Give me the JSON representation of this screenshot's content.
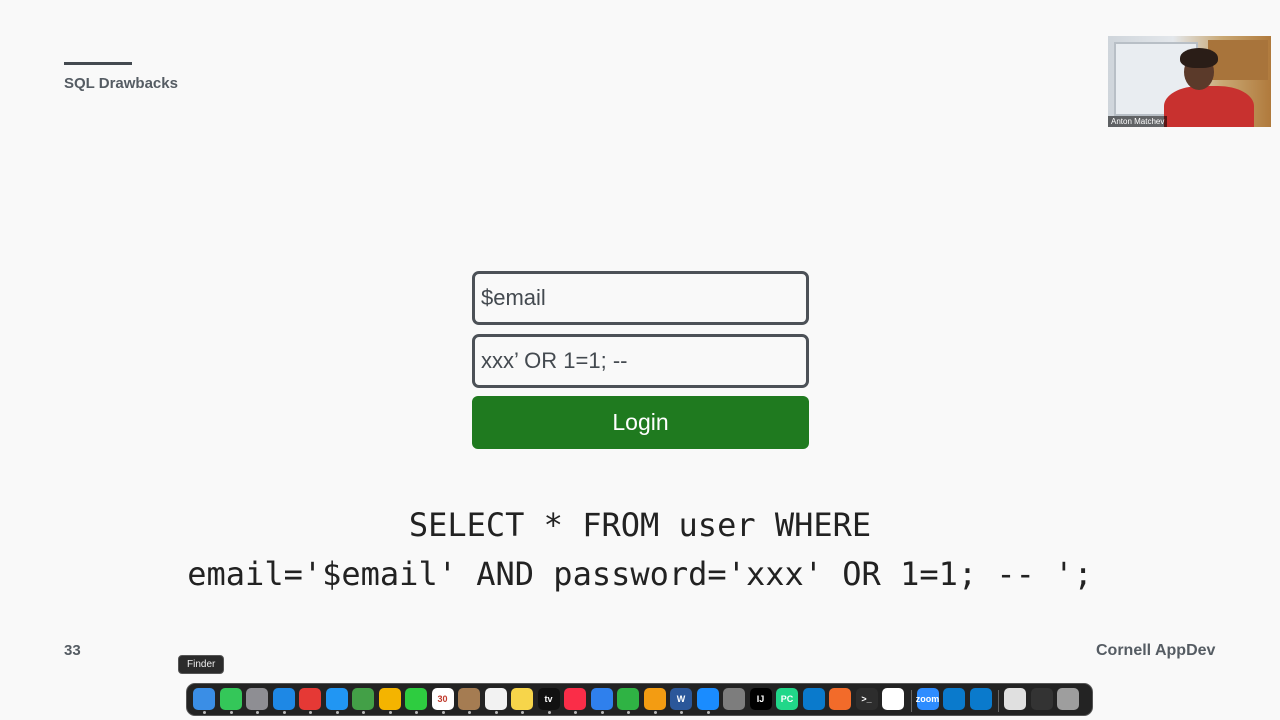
{
  "slide": {
    "section_title": "SQL Drawbacks",
    "page_number": "33",
    "brand": "Cornell AppDev"
  },
  "webcam": {
    "participant_name": "Anton Matchev"
  },
  "login_form": {
    "email_value": "$email",
    "password_value": "xxx’ OR 1=1; --",
    "login_label": "Login",
    "button_color": "#1f7a1f"
  },
  "code": {
    "line1": "SELECT * FROM user WHERE",
    "line2": "email='$email' AND password='xxx' OR 1=1; -- ';"
  },
  "dock": {
    "tooltip": "Finder",
    "icons": [
      {
        "name": "finder-icon",
        "color": "#3a8ee6"
      },
      {
        "name": "messages-icon",
        "color": "#34c759"
      },
      {
        "name": "launchpad-icon",
        "color": "#8e8e93"
      },
      {
        "name": "safari-icon",
        "color": "#1e88e5"
      },
      {
        "name": "chrome-icon",
        "color": "#e53935"
      },
      {
        "name": "mail-icon",
        "color": "#2196f3"
      },
      {
        "name": "maps-icon",
        "color": "#43a047"
      },
      {
        "name": "photos-icon",
        "color": "#f4b400"
      },
      {
        "name": "facetime-icon",
        "color": "#2ecc40"
      },
      {
        "name": "calendar-icon",
        "color": "#ffffff",
        "label": "30"
      },
      {
        "name": "contacts-icon",
        "color": "#a57c52"
      },
      {
        "name": "reminders-icon",
        "color": "#f2f2f2"
      },
      {
        "name": "notes-icon",
        "color": "#f7d54a"
      },
      {
        "name": "apple-tv-icon",
        "color": "#111111",
        "label": "tv"
      },
      {
        "name": "music-icon",
        "color": "#fa2d48"
      },
      {
        "name": "keynote-icon",
        "color": "#2f80ed"
      },
      {
        "name": "numbers-icon",
        "color": "#2fb344"
      },
      {
        "name": "pages-icon",
        "color": "#f39c12"
      },
      {
        "name": "word-icon",
        "color": "#2b579a",
        "label": "W"
      },
      {
        "name": "app-store-icon",
        "color": "#1a8cff"
      },
      {
        "name": "system-settings-icon",
        "color": "#7d7d7d"
      },
      {
        "name": "intellij-icon",
        "color": "#000000",
        "label": "IJ"
      },
      {
        "name": "pycharm-icon",
        "color": "#21d789",
        "label": "PC"
      },
      {
        "name": "vscode-icon",
        "color": "#0a7acc"
      },
      {
        "name": "sketch-icon",
        "color": "#f26b2a"
      },
      {
        "name": "terminal-icon",
        "color": "#2d2d2d",
        "label": ">_"
      },
      {
        "name": "slack-icon",
        "color": "#ffffff"
      },
      {
        "name": "zoom-icon",
        "color": "#2d8cff",
        "label": "zoom"
      },
      {
        "name": "vscode-insiders-icon",
        "color": "#0a7acc"
      },
      {
        "name": "vscode-alt-icon",
        "color": "#0a7acc"
      },
      {
        "name": "document-icon",
        "color": "#e0e0e0"
      },
      {
        "name": "window-preview-icon",
        "color": "#333333"
      },
      {
        "name": "trash-icon",
        "color": "#9e9e9e"
      }
    ]
  }
}
